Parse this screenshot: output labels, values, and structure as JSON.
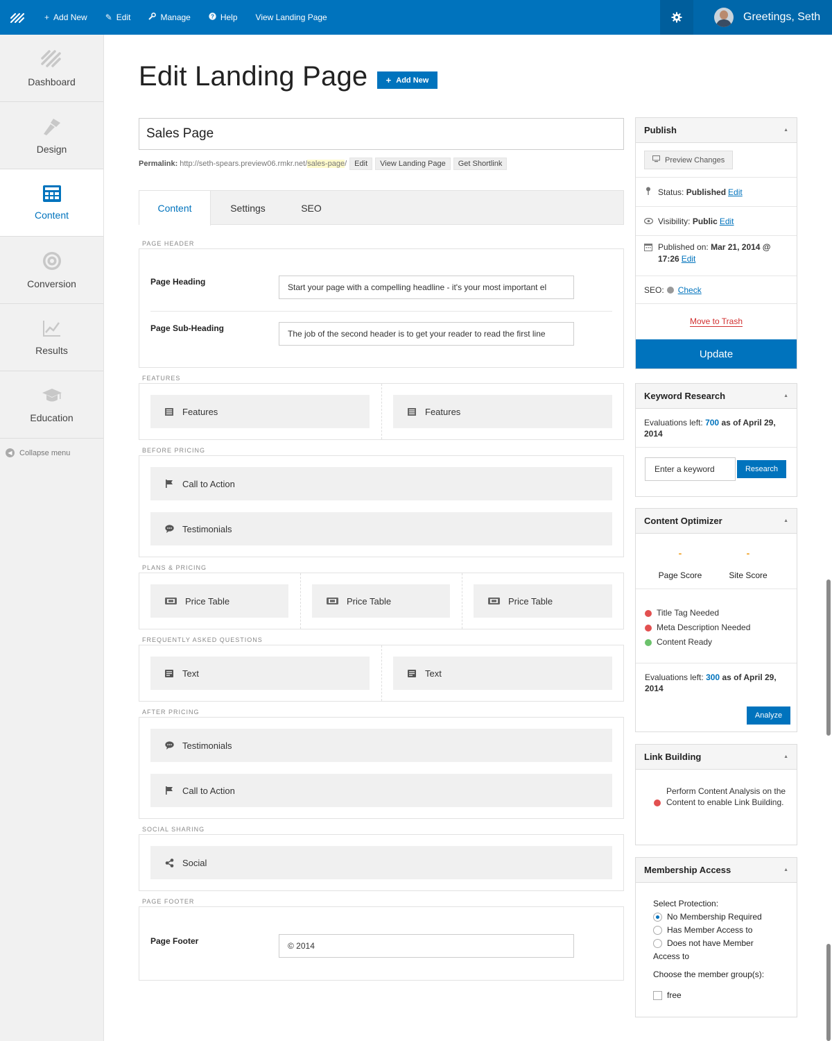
{
  "topbar": {
    "items": [
      {
        "icon": "plus-icon",
        "glyph": "+",
        "label": "Add New"
      },
      {
        "icon": "pencil-icon",
        "glyph": "✎",
        "label": "Edit"
      },
      {
        "icon": "wrench-icon",
        "glyph": "🔧",
        "label": "Manage"
      },
      {
        "icon": "help-icon",
        "glyph": "?",
        "label": "Help"
      },
      {
        "icon": "",
        "glyph": "",
        "label": "View Landing Page"
      }
    ],
    "greeting": "Greetings, Seth",
    "bar_color": "#0073bd"
  },
  "sidebar": {
    "items": [
      {
        "label": "Dashboard",
        "icon": "dashboard-icon"
      },
      {
        "label": "Design",
        "icon": "brush-icon"
      },
      {
        "label": "Content",
        "icon": "content-grid-icon",
        "active": true
      },
      {
        "label": "Conversion",
        "icon": "target-icon"
      },
      {
        "label": "Results",
        "icon": "chart-icon"
      },
      {
        "label": "Education",
        "icon": "graduation-cap-icon"
      }
    ],
    "collapse": "Collapse menu"
  },
  "main": {
    "title": "Edit Landing Page",
    "add_new": "Add New",
    "page_title_value": "Sales Page",
    "permalink": {
      "label": "Permalink:",
      "base": "http://seth-spears.preview06.rmkr.net/",
      "slug": "sales-page",
      "trail": "/",
      "buttons": [
        "Edit",
        "View Landing Page",
        "Get Shortlink"
      ]
    },
    "tabs": [
      "Content",
      "Settings",
      "SEO"
    ],
    "sections": {
      "page_header": {
        "label": "Page Header",
        "heading_label": "Page Heading",
        "heading_value": "Start your page with a compelling headline - it's your most important el",
        "subheading_label": "Page Sub-Heading",
        "subheading_value": "The job of the second header is to get your reader to read the first line"
      },
      "features": {
        "label": "Features",
        "blocks": [
          "Features",
          "Features"
        ]
      },
      "before_pricing": {
        "label": "Before Pricing",
        "blocks": [
          "Call to Action",
          "Testimonials"
        ]
      },
      "plans_pricing": {
        "label": "Plans & Pricing",
        "blocks": [
          "Price Table",
          "Price Table",
          "Price Table"
        ]
      },
      "faq": {
        "label": "Frequently Asked Questions",
        "blocks": [
          "Text",
          "Text"
        ]
      },
      "after_pricing": {
        "label": "After Pricing",
        "blocks": [
          "Testimonials",
          "Call to Action"
        ]
      },
      "social": {
        "label": "Social Sharing",
        "blocks": [
          "Social"
        ]
      },
      "footer": {
        "label": "Page Footer",
        "field_label": "Page Footer",
        "field_value": "© 2014"
      }
    }
  },
  "publish": {
    "title": "Publish",
    "preview": "Preview Changes",
    "status_label": "Status:",
    "status_value": "Published",
    "visibility_label": "Visibility:",
    "visibility_value": "Public",
    "published_label": "Published on:",
    "published_value": "Mar 21, 2014 @",
    "published_time": "17:26",
    "edit": "Edit",
    "seo_label": "SEO:",
    "seo_check": "Check",
    "trash": "Move to Trash",
    "update": "Update"
  },
  "keyword": {
    "title": "Keyword Research",
    "eval_prefix": "Evaluations left:",
    "eval_count": "700",
    "eval_suffix": "as of April 29,",
    "eval_year": "2014",
    "placeholder": "Enter a keyword",
    "button": "Research"
  },
  "optimizer": {
    "title": "Content Optimizer",
    "page_score_value": "-",
    "page_score_label": "Page Score",
    "site_score_value": "-",
    "site_score_label": "Site Score",
    "checks": [
      {
        "status": "red",
        "label": "Title Tag Needed"
      },
      {
        "status": "red",
        "label": "Meta Description Needed"
      },
      {
        "status": "green",
        "label": "Content Ready"
      }
    ],
    "eval_prefix": "Evaluations left:",
    "eval_count": "300",
    "eval_suffix": "as of April 29,",
    "eval_year": "2014",
    "button": "Analyze"
  },
  "linkbuilding": {
    "title": "Link Building",
    "message": "Perform Content Analysis on the Content to enable Link Building."
  },
  "membership": {
    "title": "Membership Access",
    "select_label": "Select Protection:",
    "options": [
      "No Membership Required",
      "Has Member Access to",
      "Does not have Member"
    ],
    "option3_wrap": "Access to",
    "groups_label": "Choose the member group(s):",
    "group": "free"
  }
}
